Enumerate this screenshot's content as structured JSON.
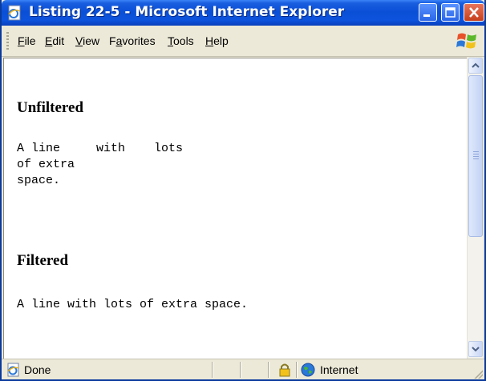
{
  "window": {
    "title": "Listing 22-5 - Microsoft Internet Explorer"
  },
  "menu": {
    "file": {
      "prefix": "",
      "key": "F",
      "rest": "ile"
    },
    "edit": {
      "prefix": "",
      "key": "E",
      "rest": "dit"
    },
    "view": {
      "prefix": "",
      "key": "V",
      "rest": "iew"
    },
    "favorites": {
      "prefix": "F",
      "key": "a",
      "rest": "vorites"
    },
    "tools": {
      "prefix": "",
      "key": "T",
      "rest": "ools"
    },
    "help": {
      "prefix": "",
      "key": "H",
      "rest": "elp"
    }
  },
  "content": {
    "heading_unfiltered": "Unfiltered",
    "pre_unfiltered": "A line     with    lots\nof extra\nspace.",
    "heading_filtered": "Filtered",
    "pre_filtered": "A line with lots of extra space."
  },
  "status": {
    "text": "Done",
    "zone": "Internet"
  },
  "colors": {
    "title_bar": "#0a4fd6",
    "chrome": "#ece9d8",
    "close_button": "#c6401c"
  },
  "icons": {
    "app": "ie-page-icon",
    "minimize": "minimize-icon",
    "maximize": "maximize-icon",
    "close": "close-icon",
    "windows_logo": "windows-logo-icon",
    "status": "ie-page-icon",
    "security": "lock-icon",
    "zone": "globe-icon"
  }
}
